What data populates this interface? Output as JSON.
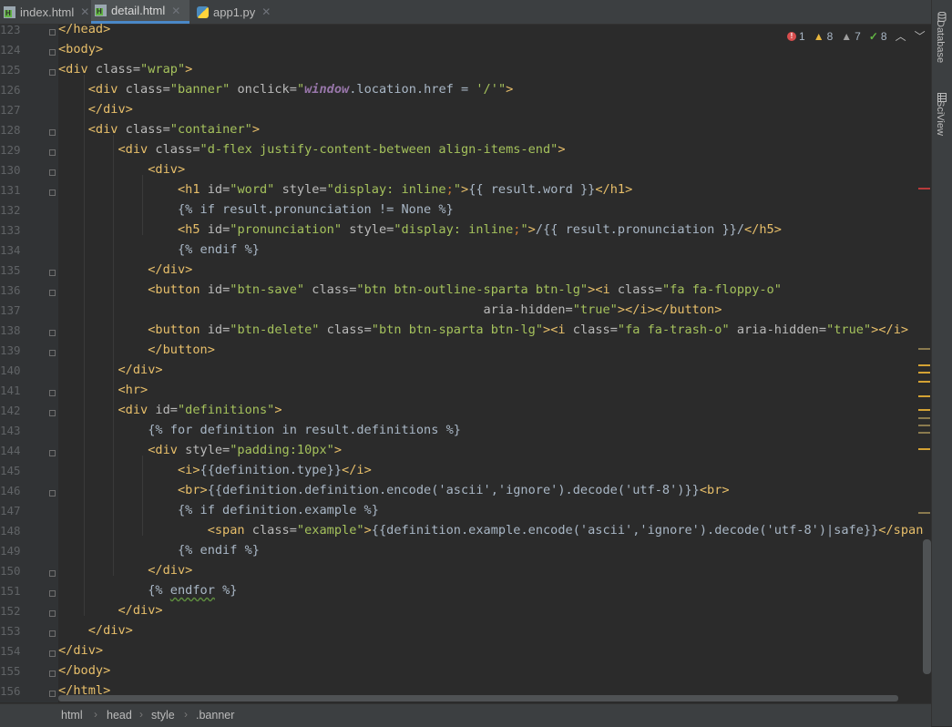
{
  "tabs": [
    {
      "label": "index.html",
      "type": "html"
    },
    {
      "label": "detail.html",
      "type": "html",
      "active": true
    },
    {
      "label": "app1.py",
      "type": "py"
    }
  ],
  "inspections": {
    "errors": "1",
    "warnings": "8",
    "weak_warnings": "7",
    "typos": "8"
  },
  "side_tabs": [
    "Database",
    "SciView"
  ],
  "breadcrumb": [
    "html",
    "head",
    "style",
    ".banner"
  ],
  "code": [
    {
      "n": "123",
      "t": [
        [
          "</head>",
          "tg"
        ]
      ]
    },
    {
      "n": "124",
      "t": [
        [
          "<body>",
          "tg"
        ]
      ]
    },
    {
      "n": "125",
      "t": [
        [
          "<div ",
          "tg"
        ],
        [
          "class=",
          "at"
        ],
        [
          "\"wrap\"",
          "av"
        ],
        [
          ">",
          "tg"
        ]
      ]
    },
    {
      "n": "126",
      "t": [
        [
          "    "
        ],
        [
          "<div ",
          "tg"
        ],
        [
          "class=",
          "at"
        ],
        [
          "\"banner\" ",
          "av"
        ],
        [
          "onclick=",
          "at"
        ],
        [
          "\"",
          "av"
        ],
        [
          "window",
          "kw"
        ],
        [
          ".location.href = ",
          "tx"
        ],
        [
          "'/'",
          "av"
        ],
        [
          "\"",
          "av"
        ],
        [
          ">",
          "tg"
        ]
      ]
    },
    {
      "n": "127",
      "t": [
        [
          "    "
        ],
        [
          "</div>",
          "tg"
        ]
      ]
    },
    {
      "n": "128",
      "t": [
        [
          "    "
        ],
        [
          "<div ",
          "tg"
        ],
        [
          "class=",
          "at"
        ],
        [
          "\"container\"",
          "av"
        ],
        [
          ">",
          "tg"
        ]
      ]
    },
    {
      "n": "129",
      "t": [
        [
          "        "
        ],
        [
          "<div ",
          "tg"
        ],
        [
          "class=",
          "at"
        ],
        [
          "\"d-flex justify-content-between align-items-end\"",
          "av"
        ],
        [
          ">",
          "tg"
        ]
      ]
    },
    {
      "n": "130",
      "t": [
        [
          "            "
        ],
        [
          "<div>",
          "tg"
        ]
      ]
    },
    {
      "n": "131",
      "t": [
        [
          "                "
        ],
        [
          "<h1 ",
          "tg"
        ],
        [
          "id=",
          "at"
        ],
        [
          "\"word\" ",
          "av"
        ],
        [
          "style=",
          "at"
        ],
        [
          "\"display: ",
          "av"
        ],
        [
          "inline",
          "av"
        ],
        [
          ";",
          "cs"
        ],
        [
          "\"",
          "av"
        ],
        [
          ">",
          "tg"
        ],
        [
          "{{ result.word }}",
          "tx"
        ],
        [
          "</h1>",
          "tg"
        ]
      ]
    },
    {
      "n": "132",
      "t": [
        [
          "                "
        ],
        [
          "{% if result.pronunciation != None %}",
          "tx"
        ]
      ]
    },
    {
      "n": "133",
      "t": [
        [
          "                "
        ],
        [
          "<h5 ",
          "tg"
        ],
        [
          "id=",
          "at"
        ],
        [
          "\"pronunciation\" ",
          "av"
        ],
        [
          "style=",
          "at"
        ],
        [
          "\"display: ",
          "av"
        ],
        [
          "inline",
          "av"
        ],
        [
          ";",
          "cs"
        ],
        [
          "\"",
          "av"
        ],
        [
          ">",
          "tg"
        ],
        [
          "/{{ result.pronunciation }}/",
          "tx"
        ],
        [
          "</h5>",
          "tg"
        ]
      ]
    },
    {
      "n": "134",
      "t": [
        [
          "                "
        ],
        [
          "{% endif %}",
          "tx"
        ]
      ]
    },
    {
      "n": "135",
      "t": [
        [
          "            "
        ],
        [
          "</div>",
          "tg"
        ]
      ]
    },
    {
      "n": "136",
      "t": [
        [
          "            "
        ],
        [
          "<button ",
          "tg"
        ],
        [
          "id=",
          "at"
        ],
        [
          "\"btn-save\" ",
          "av"
        ],
        [
          "class=",
          "at"
        ],
        [
          "\"btn btn-outline-sparta btn-lg\"",
          "av"
        ],
        [
          ">",
          "tg"
        ],
        [
          "<i ",
          "tg"
        ],
        [
          "class=",
          "at"
        ],
        [
          "\"fa fa-floppy-o\"",
          "av"
        ]
      ]
    },
    {
      "n": "137",
      "t": [
        [
          "                                                         "
        ],
        [
          "aria-hidden=",
          "at"
        ],
        [
          "\"true\"",
          "av"
        ],
        [
          ">",
          "tg"
        ],
        [
          "</i>",
          "tg"
        ],
        [
          "</button>",
          "tg"
        ]
      ]
    },
    {
      "n": "138",
      "t": [
        [
          "            "
        ],
        [
          "<button ",
          "tg"
        ],
        [
          "id=",
          "at"
        ],
        [
          "\"btn-delete\" ",
          "av"
        ],
        [
          "class=",
          "at"
        ],
        [
          "\"btn btn-sparta btn-lg\"",
          "av"
        ],
        [
          ">",
          "tg"
        ],
        [
          "<i ",
          "tg"
        ],
        [
          "class=",
          "at"
        ],
        [
          "\"fa fa-trash-o\" ",
          "av"
        ],
        [
          "aria-hidden=",
          "at"
        ],
        [
          "\"true\"",
          "av"
        ],
        [
          ">",
          "tg"
        ],
        [
          "</i>",
          "tg"
        ]
      ]
    },
    {
      "n": "139",
      "t": [
        [
          "            "
        ],
        [
          "</button>",
          "tg"
        ]
      ]
    },
    {
      "n": "140",
      "t": [
        [
          "        "
        ],
        [
          "</div>",
          "tg"
        ]
      ]
    },
    {
      "n": "141",
      "t": [
        [
          "        "
        ],
        [
          "<hr>",
          "tg"
        ]
      ]
    },
    {
      "n": "142",
      "t": [
        [
          "        "
        ],
        [
          "<div ",
          "tg"
        ],
        [
          "id=",
          "at"
        ],
        [
          "\"definitions\"",
          "av"
        ],
        [
          ">",
          "tg"
        ]
      ]
    },
    {
      "n": "143",
      "t": [
        [
          "            "
        ],
        [
          "{% for definition in result.definitions %}",
          "tx"
        ]
      ]
    },
    {
      "n": "144",
      "t": [
        [
          "            "
        ],
        [
          "<div ",
          "tg"
        ],
        [
          "style=",
          "at"
        ],
        [
          "\"padding:",
          "av"
        ],
        [
          "10px",
          "av"
        ],
        [
          "\"",
          "av"
        ],
        [
          ">",
          "tg"
        ]
      ]
    },
    {
      "n": "145",
      "t": [
        [
          "                "
        ],
        [
          "<i>",
          "tg"
        ],
        [
          "{{definition.type}}",
          "tx"
        ],
        [
          "</i>",
          "tg"
        ]
      ]
    },
    {
      "n": "146",
      "t": [
        [
          "                "
        ],
        [
          "<br>",
          "tg"
        ],
        [
          "{{definition.definition.encode('ascii','ignore').decode('utf-8')}}",
          "tx"
        ],
        [
          "<br>",
          "tg"
        ]
      ]
    },
    {
      "n": "147",
      "t": [
        [
          "                "
        ],
        [
          "{% if definition.example %}",
          "tx"
        ]
      ]
    },
    {
      "n": "148",
      "t": [
        [
          "                    "
        ],
        [
          "<span ",
          "tg"
        ],
        [
          "class=",
          "at"
        ],
        [
          "\"example\"",
          "av"
        ],
        [
          ">",
          "tg"
        ],
        [
          "{{definition.example.encode('ascii','ignore').decode('utf-8')|safe}}",
          "tx"
        ],
        [
          "</span>",
          "tg"
        ]
      ]
    },
    {
      "n": "149",
      "t": [
        [
          "                "
        ],
        [
          "{% endif %}",
          "tx"
        ]
      ]
    },
    {
      "n": "150",
      "t": [
        [
          "            "
        ],
        [
          "</div>",
          "tg"
        ]
      ]
    },
    {
      "n": "151",
      "t": [
        [
          "            "
        ],
        [
          "{% ",
          "tx"
        ],
        [
          "endfor",
          "sq"
        ],
        [
          " %}",
          "tx"
        ]
      ]
    },
    {
      "n": "152",
      "t": [
        [
          "        "
        ],
        [
          "</div>",
          "tg"
        ]
      ]
    },
    {
      "n": "153",
      "t": [
        [
          "    "
        ],
        [
          "</div>",
          "tg"
        ]
      ]
    },
    {
      "n": "154",
      "t": [
        [
          "</div>",
          "tg"
        ]
      ]
    },
    {
      "n": "155",
      "t": [
        [
          "</body>",
          "tg"
        ]
      ]
    },
    {
      "n": "156",
      "t": [
        [
          "</html>",
          "tg"
        ]
      ]
    }
  ]
}
